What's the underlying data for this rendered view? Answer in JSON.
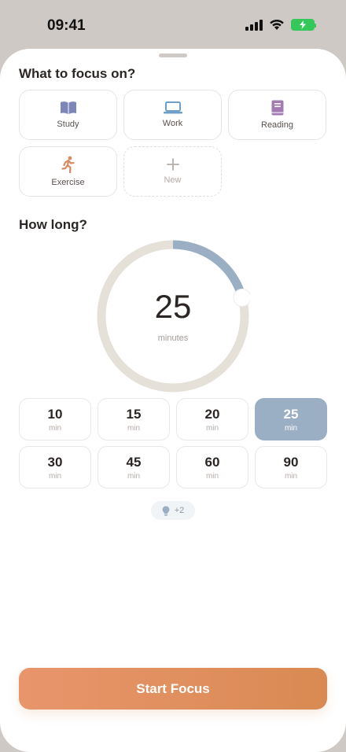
{
  "status_bar": {
    "time": "09:41"
  },
  "focus_section": {
    "title": "What to focus on?",
    "categories": [
      {
        "label": "Study",
        "icon": "book-icon",
        "color": "#7d86b8"
      },
      {
        "label": "Work",
        "icon": "laptop-icon",
        "color": "#6f9fc8"
      },
      {
        "label": "Reading",
        "icon": "notebook-icon",
        "color": "#a27bb0"
      },
      {
        "label": "Exercise",
        "icon": "running-icon",
        "color": "#d58a62"
      },
      {
        "label": "New",
        "icon": "plus-icon",
        "color": "#b4aca7"
      }
    ]
  },
  "duration_section": {
    "title": "How long?",
    "dial": {
      "value": "25",
      "unit": "minutes",
      "progress_fraction": 0.2083
    },
    "options": [
      {
        "value": "10",
        "unit": "min",
        "selected": false
      },
      {
        "value": "15",
        "unit": "min",
        "selected": false
      },
      {
        "value": "20",
        "unit": "min",
        "selected": false
      },
      {
        "value": "25",
        "unit": "min",
        "selected": true
      },
      {
        "value": "30",
        "unit": "min",
        "selected": false
      },
      {
        "value": "45",
        "unit": "min",
        "selected": false
      },
      {
        "value": "60",
        "unit": "min",
        "selected": false
      },
      {
        "value": "90",
        "unit": "min",
        "selected": false
      }
    ]
  },
  "tip": {
    "icon": "lightbulb-icon",
    "label": "+2"
  },
  "primary_action": {
    "label": "Start Focus"
  },
  "colors": {
    "accent_start": "#e8956c",
    "accent_end": "#d98a52",
    "dial_track": "#e5e0d8",
    "dial_progress": "#9bafc4",
    "selected_duration": "#9bafc4"
  }
}
